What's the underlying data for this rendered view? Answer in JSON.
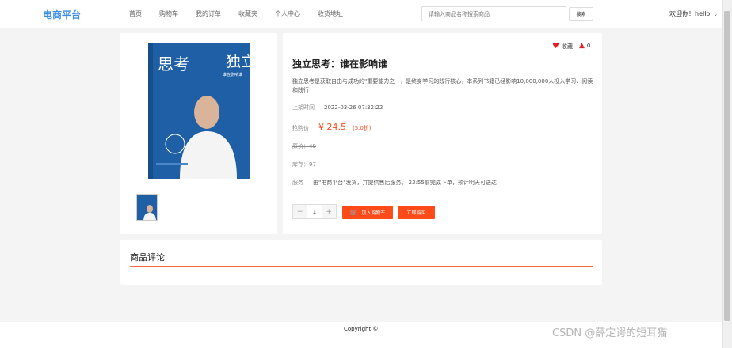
{
  "header": {
    "logo": "电商平台",
    "nav": [
      "首页",
      "购物车",
      "我的订单",
      "收藏夹",
      "个人中心",
      "收货地址"
    ],
    "search_placeholder": "请输入商品名称搜索商品",
    "search_button": "搜索",
    "welcome": "欢迎你！hello"
  },
  "product": {
    "favorite_label": "收藏",
    "likes": "0",
    "title": "独立思考：谁在影响谁",
    "description": "独立思考是获取自由与成功的\"重要能力之一，是终身学习的践行核心，本系列书籍已经影响10,000,000人投入学习、阅读和践行",
    "listed_label": "上架时间",
    "listed_value": "2022-03-26 07:32:22",
    "price_label": "抢购价",
    "price": "¥ 24.5",
    "discount": "(5.0折)",
    "original_price": "原价：49",
    "stock": "库存：97",
    "service_label": "服务",
    "service_value": "由\"电商平台\"发货，并提供售后服务。 23:55前完成下单，预计明天可送达",
    "quantity": "1",
    "add_to_cart": "加入购物车",
    "buy_now": "立即购买",
    "cover_title_1": "独立",
    "cover_title_2": "思考",
    "cover_subtitle": "谁在影响谁"
  },
  "comments": {
    "heading": "商品评论"
  },
  "footer": {
    "copyright": "Copyright ©"
  },
  "watermark": "CSDN @薛定谔的短耳猫",
  "colors": {
    "accent": "#ff4a1a",
    "logo": "#3b8ee8",
    "book_blue": "#1e5fa6"
  }
}
